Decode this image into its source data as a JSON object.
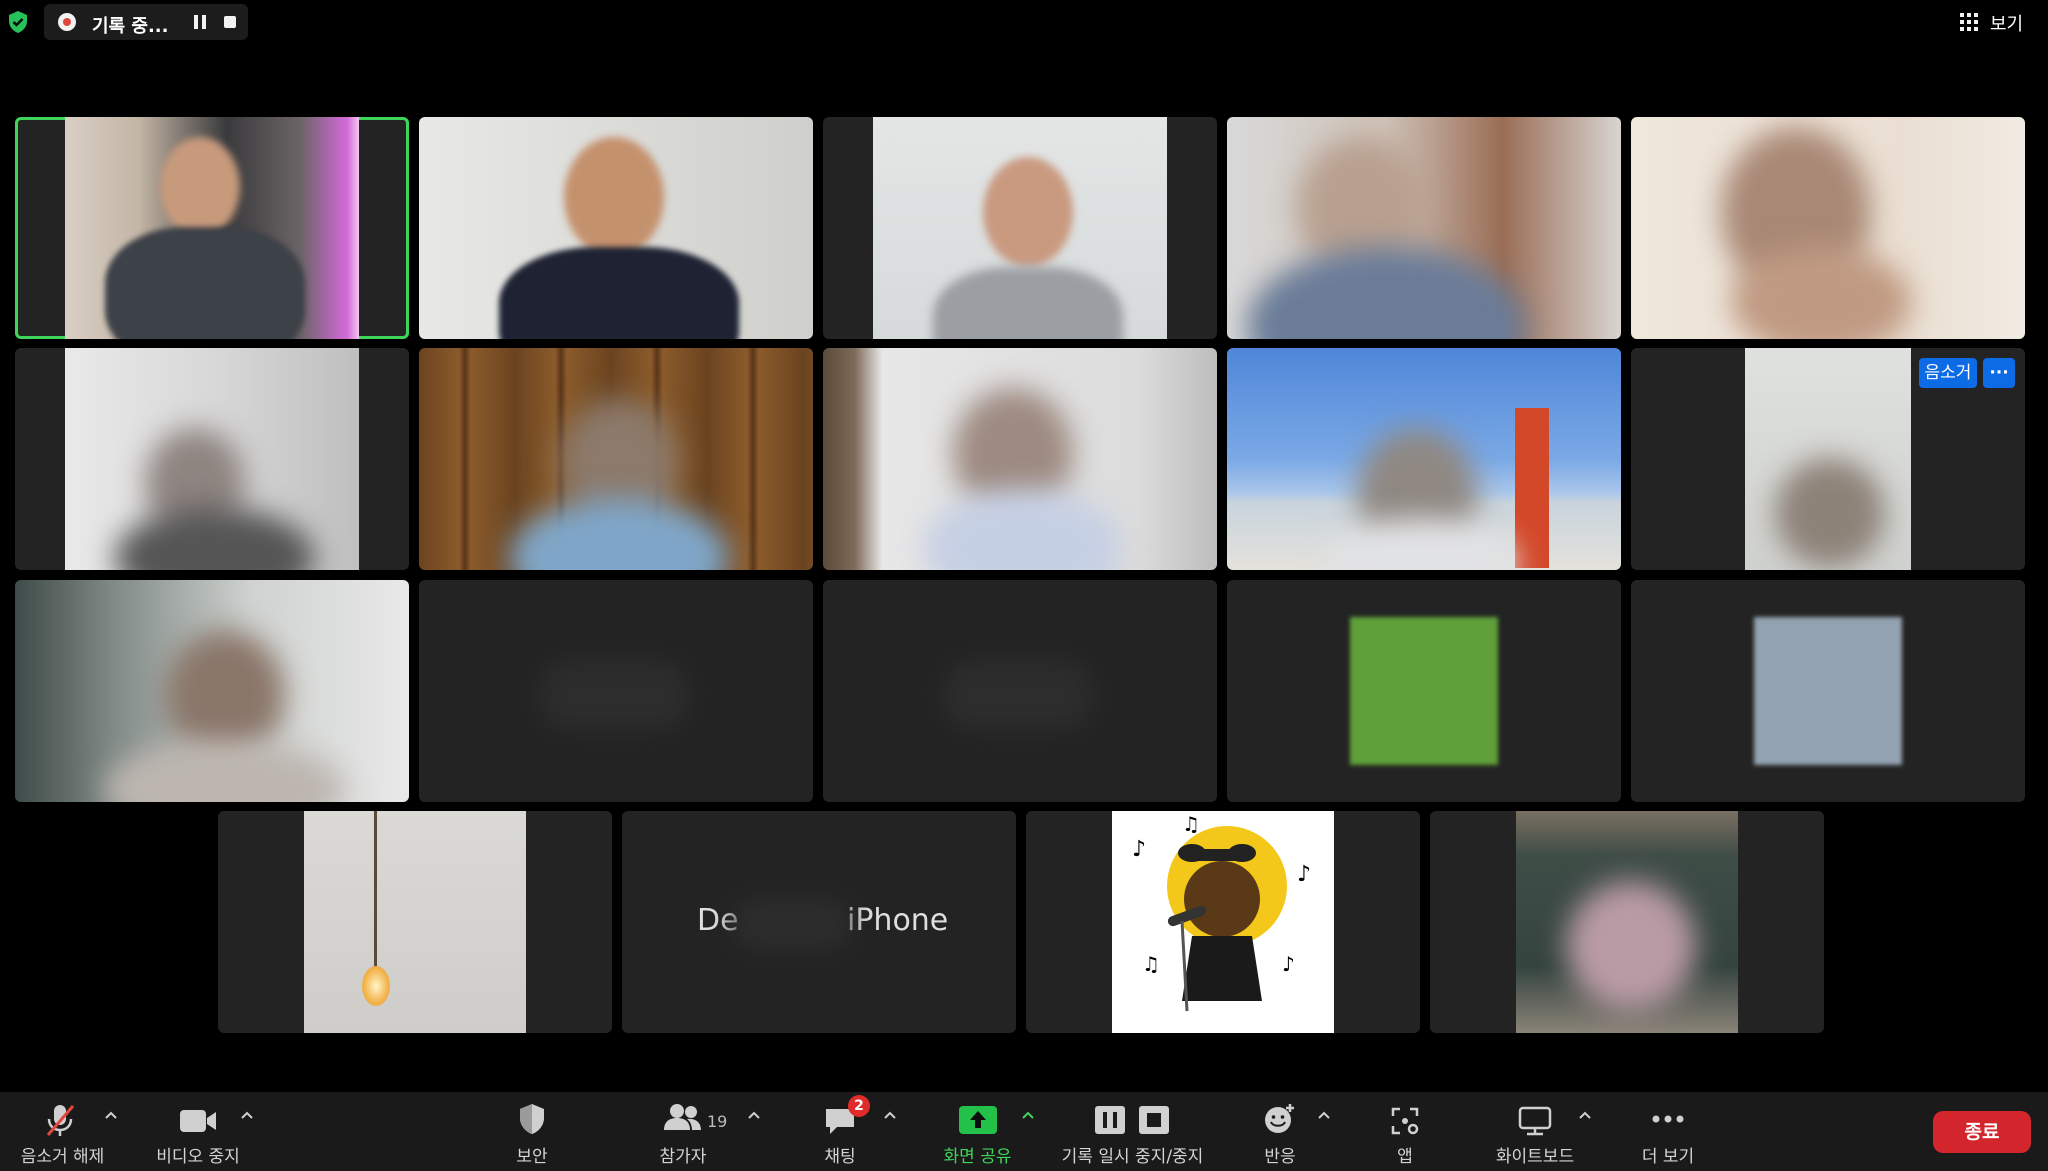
{
  "topbar": {
    "security_icon": "shield-check-icon",
    "recording_label": "기록 중...",
    "view_label": "보기"
  },
  "tiles": [
    {
      "id": 1,
      "kind": "video",
      "active": true
    },
    {
      "id": 2,
      "kind": "video"
    },
    {
      "id": 3,
      "kind": "video"
    },
    {
      "id": 4,
      "kind": "video"
    },
    {
      "id": 5,
      "kind": "video"
    },
    {
      "id": 6,
      "kind": "video"
    },
    {
      "id": 7,
      "kind": "video"
    },
    {
      "id": 8,
      "kind": "video"
    },
    {
      "id": 9,
      "kind": "video"
    },
    {
      "id": 10,
      "kind": "video",
      "badge": "음소거",
      "more": "···"
    },
    {
      "id": 11,
      "kind": "video"
    },
    {
      "id": 12,
      "kind": "name"
    },
    {
      "id": 13,
      "kind": "name"
    },
    {
      "id": 14,
      "kind": "avatar"
    },
    {
      "id": 15,
      "kind": "avatar"
    },
    {
      "id": 16,
      "kind": "video"
    },
    {
      "id": 17,
      "kind": "name",
      "name_left": "De",
      "name_right": "iPhone"
    },
    {
      "id": 18,
      "kind": "image"
    },
    {
      "id": 19,
      "kind": "video"
    }
  ],
  "toolbar": {
    "unmute": "음소거 해제",
    "stop_video": "비디오 중지",
    "security": "보안",
    "participants": "참가자",
    "participants_count": "19",
    "chat": "채팅",
    "chat_badge": "2",
    "share_screen": "화면 공유",
    "pause_stop_recording": "기록 일시 중지/중지",
    "reactions": "반응",
    "apps": "앱",
    "whiteboard": "화이트보드",
    "more": "더 보기",
    "end": "종료"
  },
  "colors": {
    "active_speaker_border": "#3dd65a",
    "share_green": "#3dd65a",
    "end_red": "#d3262c",
    "badge_blue": "#0e6be6"
  }
}
